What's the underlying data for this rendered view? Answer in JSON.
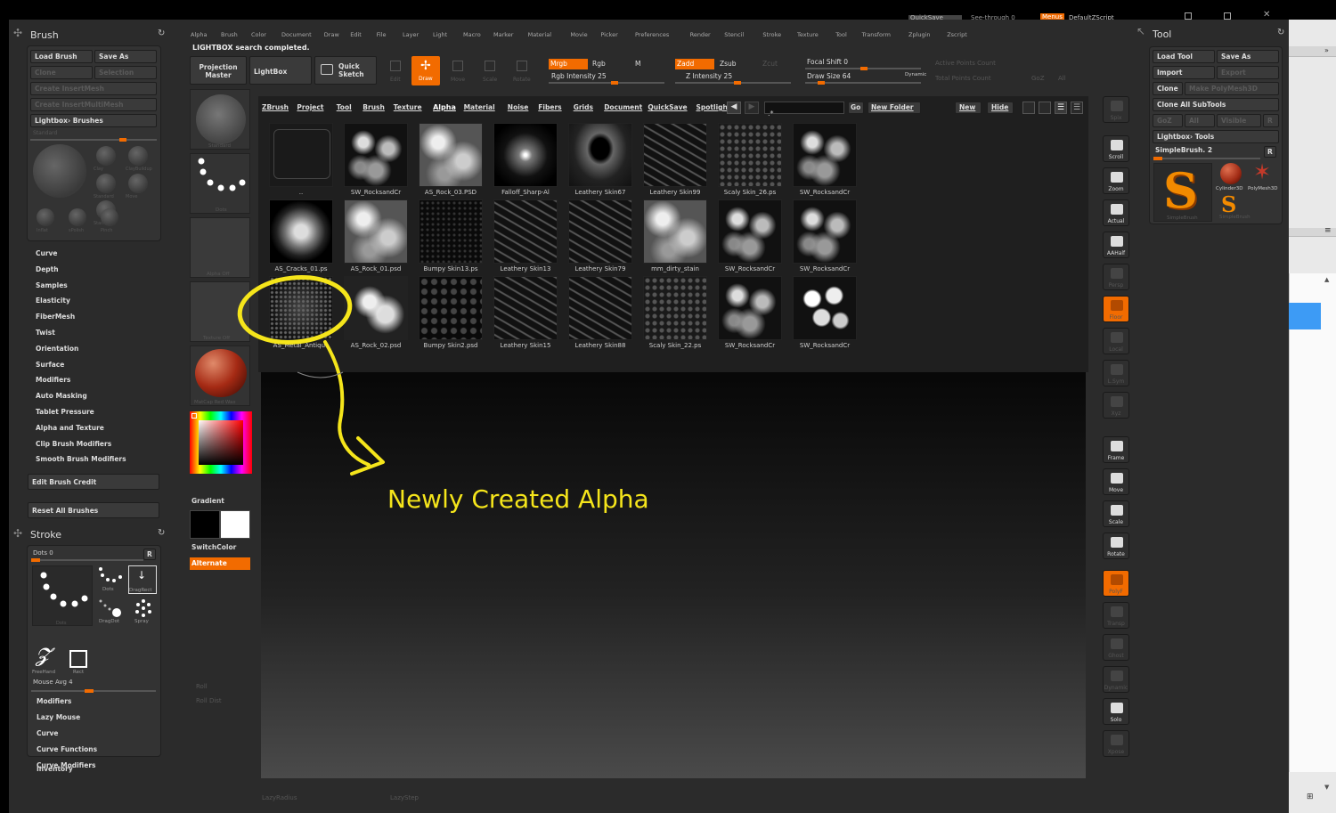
{
  "titlebar": {
    "quicksave": "QuickSave",
    "see_through": "See-through 0",
    "menus": "Menus",
    "default_script": "DefaultZScript"
  },
  "menubar": [
    "Alpha",
    "Brush",
    "Color",
    "Document",
    "Draw",
    "Edit",
    "File",
    "Layer",
    "Light",
    "Macro",
    "Marker",
    "Material",
    "Movie",
    "Picker",
    "Preferences",
    "Render",
    "Stencil",
    "Stroke",
    "Texture",
    "Tool",
    "Transform",
    "Zplugin",
    "Zscript"
  ],
  "status": "LIGHTBOX search completed.",
  "brush_palette": {
    "title": "Brush",
    "load_brush": "Load Brush",
    "save_as": "Save As",
    "clone": "Clone",
    "selection": "Selection",
    "create_insertmesh": "Create InsertMesh",
    "create_insertmultimesh": "Create InsertMultiMesh",
    "lightbox_brushes": "Lightbox› Brushes",
    "current_label": "Standard",
    "brushes": [
      "Clay",
      "ClayBuildup",
      "Standard",
      "Move",
      "Standard",
      "Inflat",
      "sPolish",
      "Pinch"
    ],
    "items": [
      "Curve",
      "Depth",
      "Samples",
      "Elasticity",
      "FiberMesh",
      "Twist",
      "Orientation",
      "Surface",
      "Modifiers",
      "Auto Masking",
      "Tablet Pressure",
      "Alpha and Texture",
      "Clip Brush Modifiers",
      "Smooth Brush Modifiers"
    ],
    "edit_brush_credit": "Edit Brush Credit",
    "reset_all_brushes": "Reset All Brushes"
  },
  "stroke_palette": {
    "title": "Stroke",
    "dots": "Dots 0",
    "r": "R",
    "types": [
      "Dots",
      "Dots",
      "DragRect",
      "DragDot",
      "Spray",
      "FreeHand",
      "Rect"
    ],
    "mouse_avg": "Mouse Avg 4",
    "items": [
      "Modifiers",
      "Lazy Mouse",
      "Curve",
      "Curve Functions",
      "Curve Modifiers"
    ],
    "inventory": "Inventory"
  },
  "shelf": {
    "brush_label": "Standard",
    "stroke_label": "Dots",
    "alpha_label": "Alpha Off",
    "texture_label": "Texture Off",
    "material_label": "MatCap Red Wax",
    "gradient": "Gradient",
    "switchcolor": "SwitchColor",
    "alternate": "Alternate",
    "roll": "Roll",
    "roll_dist": "Roll Dist",
    "lazyradius": "LazyRadius",
    "lazystep": "LazyStep"
  },
  "toolbar": {
    "projection_master": "Projection Master",
    "lightbox": "LightBox",
    "quick_sketch": "Quick Sketch",
    "edit": "Edit",
    "draw": "Draw",
    "move": "Move",
    "scale": "Scale",
    "rotate": "Rotate",
    "mrgb": "Mrgb",
    "rgb": "Rgb",
    "m": "M",
    "rgb_intensity": "Rgb Intensity 25",
    "zadd": "Zadd",
    "zsub": "Zsub",
    "zcut": "Zcut",
    "z_intensity": "Z Intensity 25",
    "focal_shift": "Focal Shift 0",
    "draw_size": "Draw Size 64",
    "dynamic": "Dynamic",
    "active_points": "Active Points Count",
    "total_points": "Total Points Count",
    "goz": "GoZ",
    "all": "All"
  },
  "lightbox": {
    "tabs": [
      "ZBrush",
      "Project",
      "Tool",
      "Brush",
      "Texture",
      "Alpha",
      "Material",
      "Noise",
      "Fibers",
      "Grids",
      "Document",
      "QuickSave",
      "Spotlight"
    ],
    "active_tab": "Alpha",
    "go": "Go",
    "new_folder": "New Folder",
    "new": "New",
    "hide": "Hide",
    "items": [
      [
        {
          "label": "..",
          "kind": "folder"
        },
        {
          "label": "SW_RocksandCr",
          "kind": "rock"
        },
        {
          "label": "AS_Rock_03.PSD",
          "kind": "noise"
        },
        {
          "label": "Falloff_Sharp-Al",
          "kind": "falloff"
        },
        {
          "label": "Leathery Skin67",
          "kind": "crack"
        },
        {
          "label": "Leathery Skin99",
          "kind": "lines"
        },
        {
          "label": "Scaly Skin_26.ps",
          "kind": "scaly"
        },
        {
          "label": "SW_RocksandCr",
          "kind": "rock"
        }
      ],
      [
        {
          "label": "AS_Cracks_01.ps",
          "kind": "sphere"
        },
        {
          "label": "AS_Rock_01.psd",
          "kind": "noise"
        },
        {
          "label": "Bumpy Skin13.ps",
          "kind": "dark"
        },
        {
          "label": "Leathery Skin13",
          "kind": "lines"
        },
        {
          "label": "Leathery Skin79",
          "kind": "lines"
        },
        {
          "label": "mm_dirty_stain",
          "kind": "noise"
        },
        {
          "label": "SW_RocksandCr",
          "kind": "rock"
        },
        {
          "label": "SW_RocksandCr",
          "kind": "rock"
        }
      ],
      [
        {
          "label": "AS_Metal_Antique",
          "kind": "metal"
        },
        {
          "label": "AS_Rock_02.psd",
          "kind": "cloud"
        },
        {
          "label": "Bumpy Skin2.psd",
          "kind": "dots"
        },
        {
          "label": "Leathery Skin15",
          "kind": "lines"
        },
        {
          "label": "Leathery Skin88",
          "kind": "lines"
        },
        {
          "label": "Scaly Skin_22.ps",
          "kind": "scaly"
        },
        {
          "label": "SW_RocksandCr",
          "kind": "rock"
        },
        {
          "label": "SW_RocksandCr",
          "kind": "pebbles"
        }
      ]
    ]
  },
  "annotation": {
    "text": "Newly Created Alpha",
    "color": "#f5e51b"
  },
  "right_toolbar": [
    "Spix",
    "Scroll",
    "Zoom",
    "Actual",
    "AAHalf",
    "Persp",
    "Floor",
    "Local",
    "L.Sym",
    "Xyz",
    "Frame",
    "Move",
    "Scale",
    "Rotate",
    "PolyF",
    "Transp",
    "Ghost",
    "Dynamic",
    "Solo",
    "Xpose"
  ],
  "tool_palette": {
    "title": "Tool",
    "load_tool": "Load Tool",
    "save_as": "Save As",
    "import": "Import",
    "export": "Export",
    "clone": "Clone",
    "make_polymesh": "Make PolyMesh3D",
    "clone_all_subtools": "Clone All SubTools",
    "goz": "GoZ",
    "all": "All",
    "visible": "Visible",
    "r": "R",
    "lightbox_tools": "Lightbox› Tools",
    "current_tool": "SimpleBrush. 2",
    "tools": [
      "SimpleBrush",
      "Cylinder3D",
      "PolyMesh3D",
      "SimpleBrush"
    ]
  },
  "colors": {
    "accent": "#f26b00",
    "panel": "#333333",
    "background": "#2b2b2b"
  }
}
